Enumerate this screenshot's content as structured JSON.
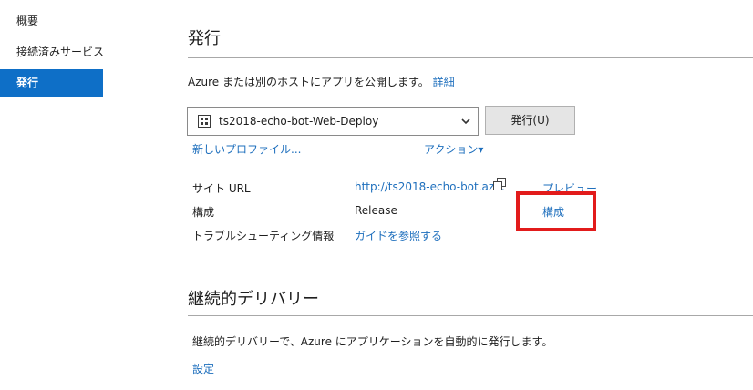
{
  "sidebar": {
    "items": [
      {
        "label": "概要"
      },
      {
        "label": "接続済みサービス"
      },
      {
        "label": "発行",
        "active": true
      }
    ]
  },
  "publish": {
    "title": "発行",
    "description": "Azure または別のホストにアプリを公開します。",
    "details_link": "詳細",
    "profile": {
      "selected": "ts2018-echo-bot-Web-Deploy",
      "icon": "web-deploy-icon"
    },
    "publish_button": "発行(U)",
    "new_profile_link": "新しいプロファイル...",
    "actions_link": "アクション▾",
    "rows": [
      {
        "label": "サイト URL",
        "value": "http://ts2018-echo-bot.az...",
        "action": "プレビュー"
      },
      {
        "label": "構成",
        "value": "Release",
        "action": "構成"
      },
      {
        "label": "トラブルシューティング情報",
        "value": "ガイドを参照する"
      }
    ]
  },
  "continuous_delivery": {
    "title": "継続的デリバリー",
    "description": "継続的デリバリーで、Azure にアプリケーションを自動的に発行します。",
    "settings_link": "設定"
  },
  "colors": {
    "accent": "#0e6fc7",
    "link": "#1e6fbd",
    "highlight": "#e21b1b"
  }
}
